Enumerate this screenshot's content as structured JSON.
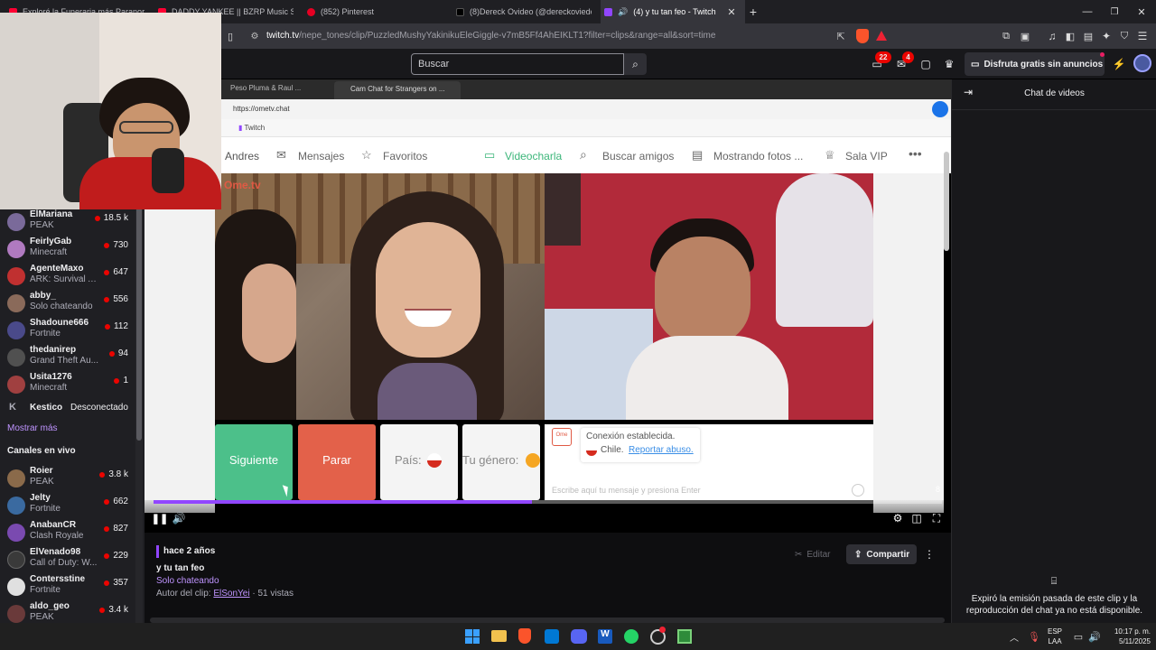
{
  "browser": {
    "tabs": [
      {
        "label": "Exploré la Funeraria más Paranormal",
        "color": "#ff0033"
      },
      {
        "label": "DADDY YANKEE || BZRP Music Sessions",
        "color": "#ff0033"
      },
      {
        "label": "(852) Pinterest",
        "color": "#e60023"
      },
      {
        "label": "(8)Dereck Ovideo (@dereckoviedo20",
        "color": "#000000"
      },
      {
        "label": "(4) y tu tan feo - Twitch",
        "color": "#9146ff"
      }
    ],
    "url_host": "twitch.tv",
    "url_path": "/nepe_tones/clip/PuzzledMushyYakinikuEleGiggle-v7mB5Ff4AhEIKLT1?filter=clips&range=all&sort=time"
  },
  "topnav": {
    "search_placeholder": "Buscar",
    "notif_badge_1": "22",
    "notif_badge_2": "4",
    "promo_label": "Disfruta gratis sin anuncios"
  },
  "sidebar": {
    "followed": [
      {
        "name": "ElMariana",
        "game": "PEAK",
        "count": "18.5 k",
        "color": "#7a6a9a"
      },
      {
        "name": "FeirlyGab",
        "game": "Minecraft",
        "count": "730",
        "color": "#b07ac0"
      },
      {
        "name": "AgenteMaxo",
        "game": "ARK: Survival A...",
        "count": "647",
        "color": "#c03030"
      },
      {
        "name": "abby_",
        "game": "Solo chateando",
        "count": "556",
        "color": "#8a6a5a"
      },
      {
        "name": "Shadoune666",
        "game": "Fortnite",
        "count": "112",
        "color": "#4a4a8a"
      },
      {
        "name": "thedanirep",
        "game": "Grand Theft Au...",
        "count": "94",
        "color": "#505050"
      },
      {
        "name": "Usita1276",
        "game": "Minecraft",
        "count": "1",
        "color": "#a04040"
      }
    ],
    "offline": {
      "name": "Kestico",
      "status": "Desconectado"
    },
    "show_more": "Mostrar más",
    "live_header": "Canales en vivo",
    "live": [
      {
        "name": "Roier",
        "game": "PEAK",
        "count": "3.8 k",
        "color": "#8a6a4a"
      },
      {
        "name": "Jelty",
        "game": "Fortnite",
        "count": "662",
        "color": "#3a6aa0"
      },
      {
        "name": "AnabanCR",
        "game": "Clash Royale",
        "count": "827",
        "color": "#7a4ab0"
      },
      {
        "name": "ElVenado98",
        "game": "Call of Duty: W...",
        "count": "229",
        "color": "#3a3a3a"
      },
      {
        "name": "Contersstine",
        "game": "Fortnite",
        "count": "357",
        "color": "#e0e0e0"
      },
      {
        "name": "aldo_geo",
        "game": "PEAK",
        "count": "3.4 k",
        "color": "#6a3a3a"
      }
    ]
  },
  "inner_browser": {
    "tabs": [
      "Peso Pluma & Raul ...",
      "Cam Chat for Strangers on ..."
    ],
    "url": "https://ometv.chat",
    "bookmark": "Twitch"
  },
  "ometv": {
    "nav_user": "Andres",
    "nav": [
      "Mensajes",
      "Favoritos",
      "Videocharla",
      "Buscar amigos",
      "Mostrando fotos ...",
      "Sala VIP"
    ],
    "logo": "Ome.tv",
    "next_button": "Siguiente",
    "stop_button": "Parar",
    "country_label": "País:",
    "gender_label": "Tu género:",
    "connection_text": "Conexión establecida.",
    "country_text": "Chile.",
    "report_link": "Reportar abuso.",
    "message_placeholder": "Escribe aquí tu mensaje y presiona Enter",
    "corner_count": "8"
  },
  "player": {
    "progress": 0.48
  },
  "clip": {
    "time_ago": "hace 2 años",
    "title": "y tu tan feo",
    "category": "Solo chateando",
    "author_label": "Autor del clip:",
    "author": "ElSonYei",
    "views": "· 51 vistas",
    "edit_label": "Editar",
    "share_label": "Compartir"
  },
  "chat": {
    "title": "Chat de videos",
    "expired_msg": "Expiró la emisión pasada de este clip y la reproducción del chat ya no está disponible."
  },
  "taskbar": {
    "lang_1": "ESP",
    "lang_2": "LAA",
    "time": "10:17 p. m.",
    "date": "5/11/2025"
  }
}
